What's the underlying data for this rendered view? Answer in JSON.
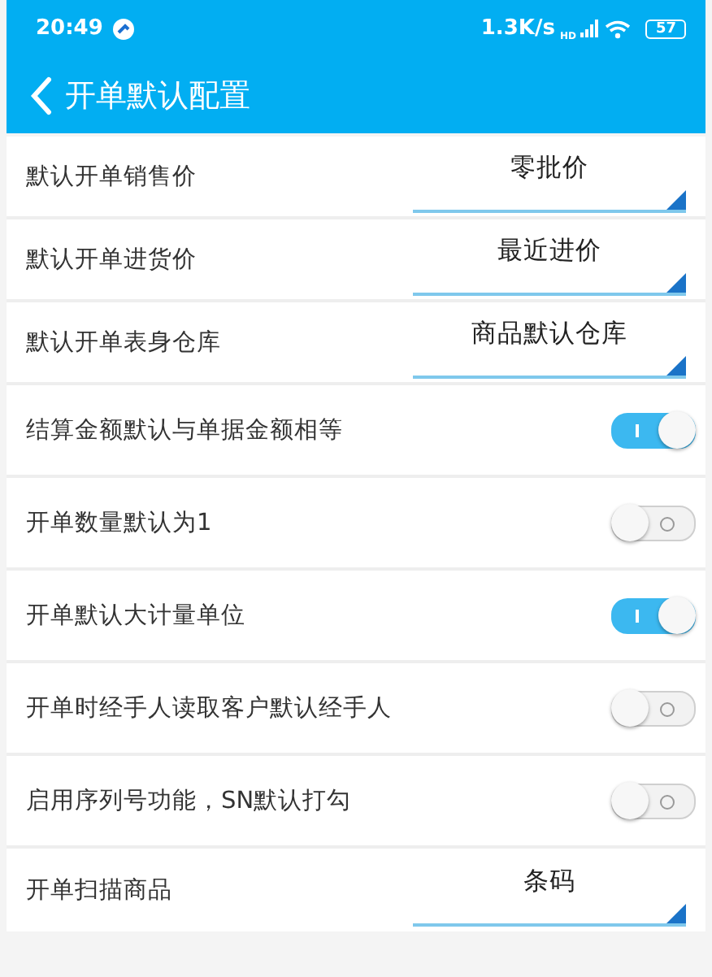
{
  "status_bar": {
    "time": "20:49",
    "speed": "1.3K/s",
    "signal_tag": "HD",
    "battery": "57"
  },
  "header": {
    "title": "开单默认配置"
  },
  "settings": [
    {
      "kind": "select",
      "label": "默认开单销售价",
      "value": "零批价"
    },
    {
      "kind": "select",
      "label": "默认开单进货价",
      "value": "最近进价"
    },
    {
      "kind": "select",
      "label": "默认开单表身仓库",
      "value": "商品默认仓库"
    },
    {
      "kind": "toggle",
      "label": "结算金额默认与单据金额相等",
      "on": true
    },
    {
      "kind": "toggle",
      "label": "开单数量默认为1",
      "on": false
    },
    {
      "kind": "toggle",
      "label": "开单默认大计量单位",
      "on": true
    },
    {
      "kind": "toggle",
      "label": "开单时经手人读取客户默认经手人",
      "on": false
    },
    {
      "kind": "toggle",
      "label": "启用序列号功能，SN默认打勾",
      "on": false
    },
    {
      "kind": "select",
      "label": "开单扫描商品",
      "value": "条码"
    }
  ]
}
